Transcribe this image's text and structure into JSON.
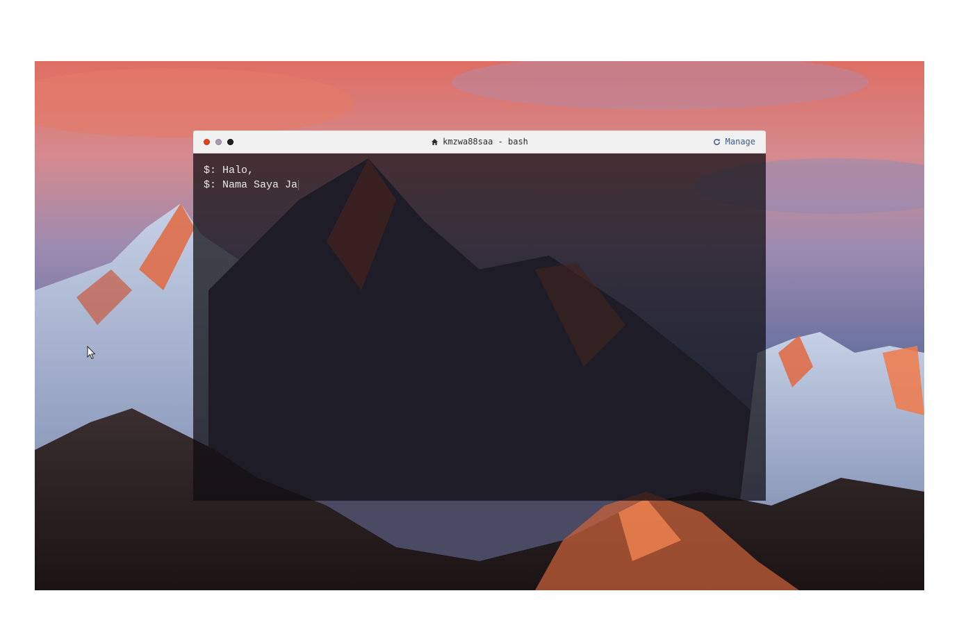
{
  "window": {
    "title": "kmzwa88saa - bash",
    "title_icon": "home-icon",
    "manage_label": "Manage",
    "manage_icon": "refresh-icon",
    "buttons": {
      "close_color": "#e1431b",
      "minimize_color": "#a99bb4",
      "maximize_color": "#222222"
    }
  },
  "terminal": {
    "prompt": "$:",
    "lines": [
      {
        "prompt": "$:",
        "text": "Halo,"
      },
      {
        "prompt": "$:",
        "text": "Nama Saya Ja"
      }
    ]
  },
  "colors": {
    "terminal_text": "#eaeaea",
    "manage_link": "#3c5a8a",
    "titlebar_bg": "#f1f1f1"
  }
}
